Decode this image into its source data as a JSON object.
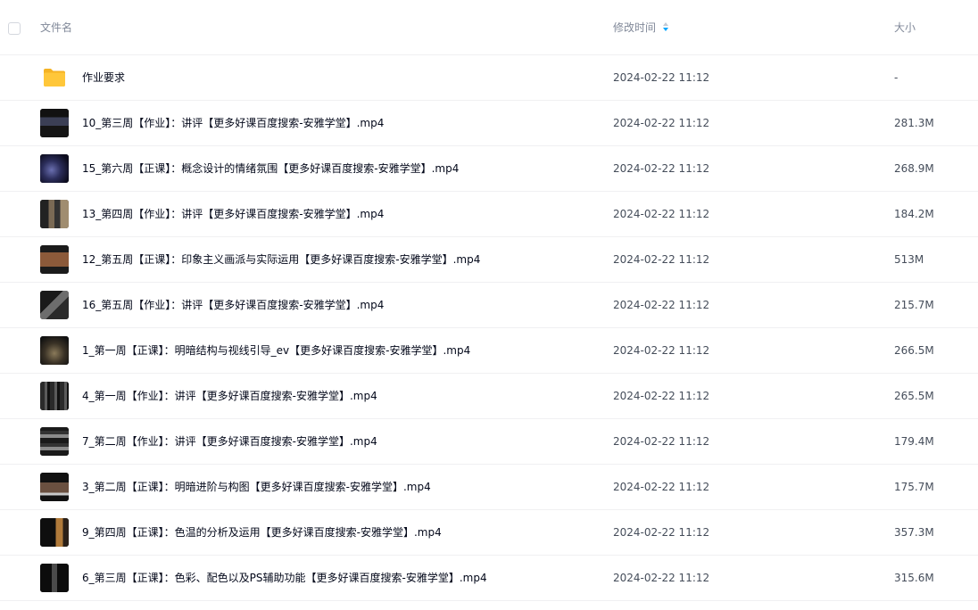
{
  "header": {
    "name_label": "文件名",
    "time_label": "修改时间",
    "size_label": "大小"
  },
  "files": [
    {
      "name": "作业要求",
      "time": "2024-02-22 11:12",
      "size": "-",
      "type": "folder-icon"
    },
    {
      "name": "10_第三周【作业】：讲评【更多好课百度搜索-安雅学堂】.mp4",
      "time": "2024-02-22 11:12",
      "size": "281.3M",
      "type": "video-thumbnail"
    },
    {
      "name": "15_第六周【正课】：概念设计的情绪氛围【更多好课百度搜索-安雅学堂】.mp4",
      "time": "2024-02-22 11:12",
      "size": "268.9M",
      "type": "video-thumbnail"
    },
    {
      "name": "13_第四周【作业】：讲评【更多好课百度搜索-安雅学堂】.mp4",
      "time": "2024-02-22 11:12",
      "size": "184.2M",
      "type": "video-thumbnail"
    },
    {
      "name": "12_第五周【正课】：印象主义画派与实际运用【更多好课百度搜索-安雅学堂】.mp4",
      "time": "2024-02-22 11:12",
      "size": "513M",
      "type": "video-thumbnail"
    },
    {
      "name": "16_第五周【作业】：讲评【更多好课百度搜索-安雅学堂】.mp4",
      "time": "2024-02-22 11:12",
      "size": "215.7M",
      "type": "video-thumbnail"
    },
    {
      "name": "1_第一周【正课】：明暗结构与视线引导_ev【更多好课百度搜索-安雅学堂】.mp4",
      "time": "2024-02-22 11:12",
      "size": "266.5M",
      "type": "video-thumbnail"
    },
    {
      "name": "4_第一周【作业】：讲评【更多好课百度搜索-安雅学堂】.mp4",
      "time": "2024-02-22 11:12",
      "size": "265.5M",
      "type": "video-thumbnail"
    },
    {
      "name": "7_第二周【作业】：讲评【更多好课百度搜索-安雅学堂】.mp4",
      "time": "2024-02-22 11:12",
      "size": "179.4M",
      "type": "video-thumbnail"
    },
    {
      "name": "3_第二周【正课】：明暗进阶与构图【更多好课百度搜索-安雅学堂】.mp4",
      "time": "2024-02-22 11:12",
      "size": "175.7M",
      "type": "video-thumbnail"
    },
    {
      "name": "9_第四周【正课】：色温的分析及运用【更多好课百度搜索-安雅学堂】.mp4",
      "time": "2024-02-22 11:12",
      "size": "357.3M",
      "type": "video-thumbnail"
    },
    {
      "name": "6_第三周【正课】：色彩、配色以及PS辅助功能【更多好课百度搜索-安雅学堂】.mp4",
      "time": "2024-02-22 11:12",
      "size": "315.6M",
      "type": "video-thumbnail"
    }
  ],
  "colors": {
    "folder": "#ffc73a",
    "sort_active": "#06a7ff",
    "divider": "#f0f0f2"
  }
}
